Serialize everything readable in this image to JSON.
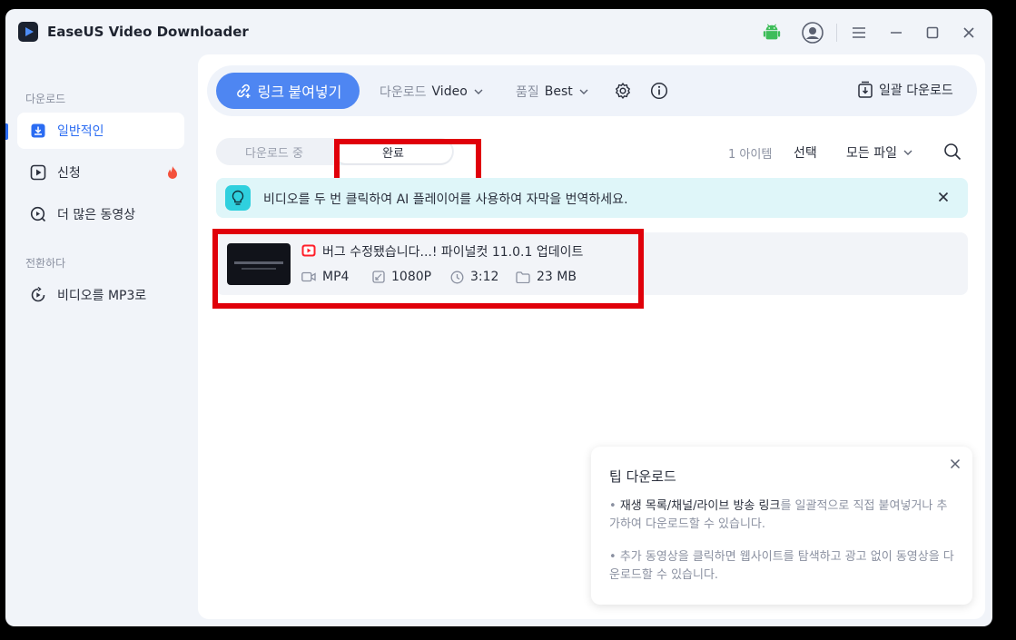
{
  "app": {
    "title": "EaseUS Video Downloader"
  },
  "titlebar": {
    "icons": [
      "android-icon",
      "avatar-icon",
      "menu-icon",
      "minimize-icon",
      "maximize-icon",
      "close-icon"
    ]
  },
  "sidebar": {
    "section_download": "다운로드",
    "items": [
      {
        "label": "일반적인",
        "icon": "download-box-icon",
        "active": true
      },
      {
        "label": "신청",
        "icon": "play-box-icon",
        "badge_icon": "fire-icon"
      },
      {
        "label": "더 많은 동영상",
        "icon": "search-video-icon"
      }
    ],
    "section_convert": "전환하다",
    "convert_items": [
      {
        "label": "비디오를 MP3로",
        "icon": "convert-icon"
      }
    ]
  },
  "toolbar": {
    "paste_label": "링크 붙여넣기",
    "download_label": "다운로드",
    "download_value": "Video",
    "quality_label": "품질",
    "quality_value": "Best",
    "batch_label": "일괄 다운로드"
  },
  "tabs": {
    "downloading": "다운로드 중",
    "done": "완료"
  },
  "list_header": {
    "count": "1 아이템",
    "select": "선택",
    "filter": "모든 파일"
  },
  "banner": {
    "text": "비디오를 두 번 클릭하여 AI 플레이어를 사용하여 자막을 번역하세요."
  },
  "items": [
    {
      "title": "버그 수정됐습니다...! 파이널컷 11.0.1 업데이트",
      "format": "MP4",
      "resolution": "1080P",
      "duration": "3:12",
      "size": "23 MB"
    }
  ],
  "tip": {
    "title": "팁 다운로드",
    "p1_hl": "재생 목록/채널/라이브 방송 링크",
    "p1_rest": "를 일괄적으로 직접 붙여넣거나 추가하여 다운로드할 수 있습니다.",
    "p2": "추가 동영상을 클릭하면 웹사이트를 탐색하고 광고 없이 동영상을 다운로드할 수 있습니다."
  },
  "colors": {
    "accent": "#4e86f2",
    "highlight_box": "#e0000a",
    "banner_bg": "#dff6f9"
  }
}
